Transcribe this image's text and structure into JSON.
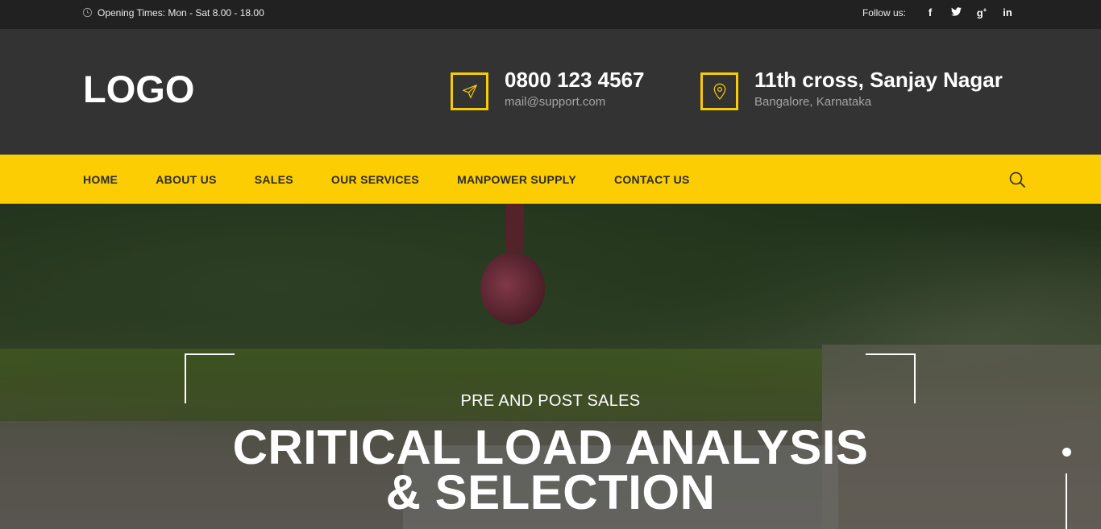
{
  "topbar": {
    "hours_text": "Opening Times: Mon - Sat 8.00 - 18.00",
    "follow_label": "Follow us:",
    "social": [
      {
        "icon": "facebook-icon",
        "glyph": "f"
      },
      {
        "icon": "twitter-icon",
        "glyph": "🐦"
      },
      {
        "icon": "google-plus-icon",
        "glyph": "g⁺"
      },
      {
        "icon": "linkedin-icon",
        "glyph": "in"
      }
    ]
  },
  "header": {
    "logo": "LOGO",
    "phone": "0800 123 4567",
    "email": "mail@support.com",
    "address_line1": "11th cross, Sanjay Nagar",
    "address_line2": "Bangalore, Karnataka"
  },
  "nav": {
    "items": [
      "HOME",
      "ABOUT US",
      "SALES",
      "OUR SERVICES",
      "MANPOWER SUPPLY",
      "CONTACT US"
    ]
  },
  "hero": {
    "kicker": "PRE AND POST SALES",
    "title_line1": "CRITICAL LOAD ANALYSIS",
    "title_line2": "& SELECTION"
  },
  "colors": {
    "accent": "#fccd02",
    "topbar_bg": "#212121",
    "header_bg": "#333333"
  }
}
